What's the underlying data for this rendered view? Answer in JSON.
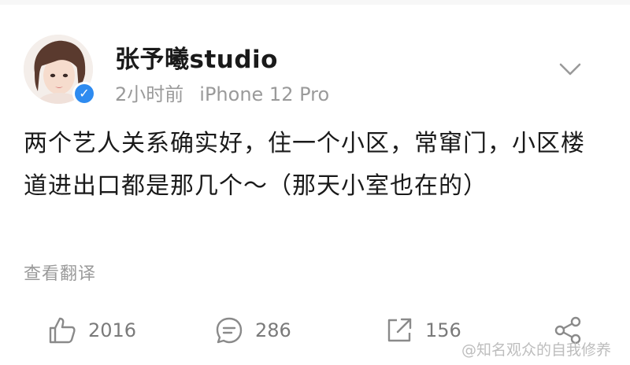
{
  "post": {
    "username": "张予曦studio",
    "time": "2小时前",
    "device": "iPhone 12 Pro",
    "verified_mark": "✓",
    "text": "两个艺人关系确实好，住一个小区，常窜门，小区楼道进出口都是那几个～（那天小室也在的）",
    "translate_label": "查看翻译"
  },
  "actions": {
    "likes": "2016",
    "comments": "286",
    "reposts": "156"
  },
  "watermark": "@知名观众的自我修养",
  "colors": {
    "verified": "#2e8bf0",
    "text": "#1a1a1a",
    "muted": "#9a9a9a",
    "icon": "#8a8a8a"
  }
}
